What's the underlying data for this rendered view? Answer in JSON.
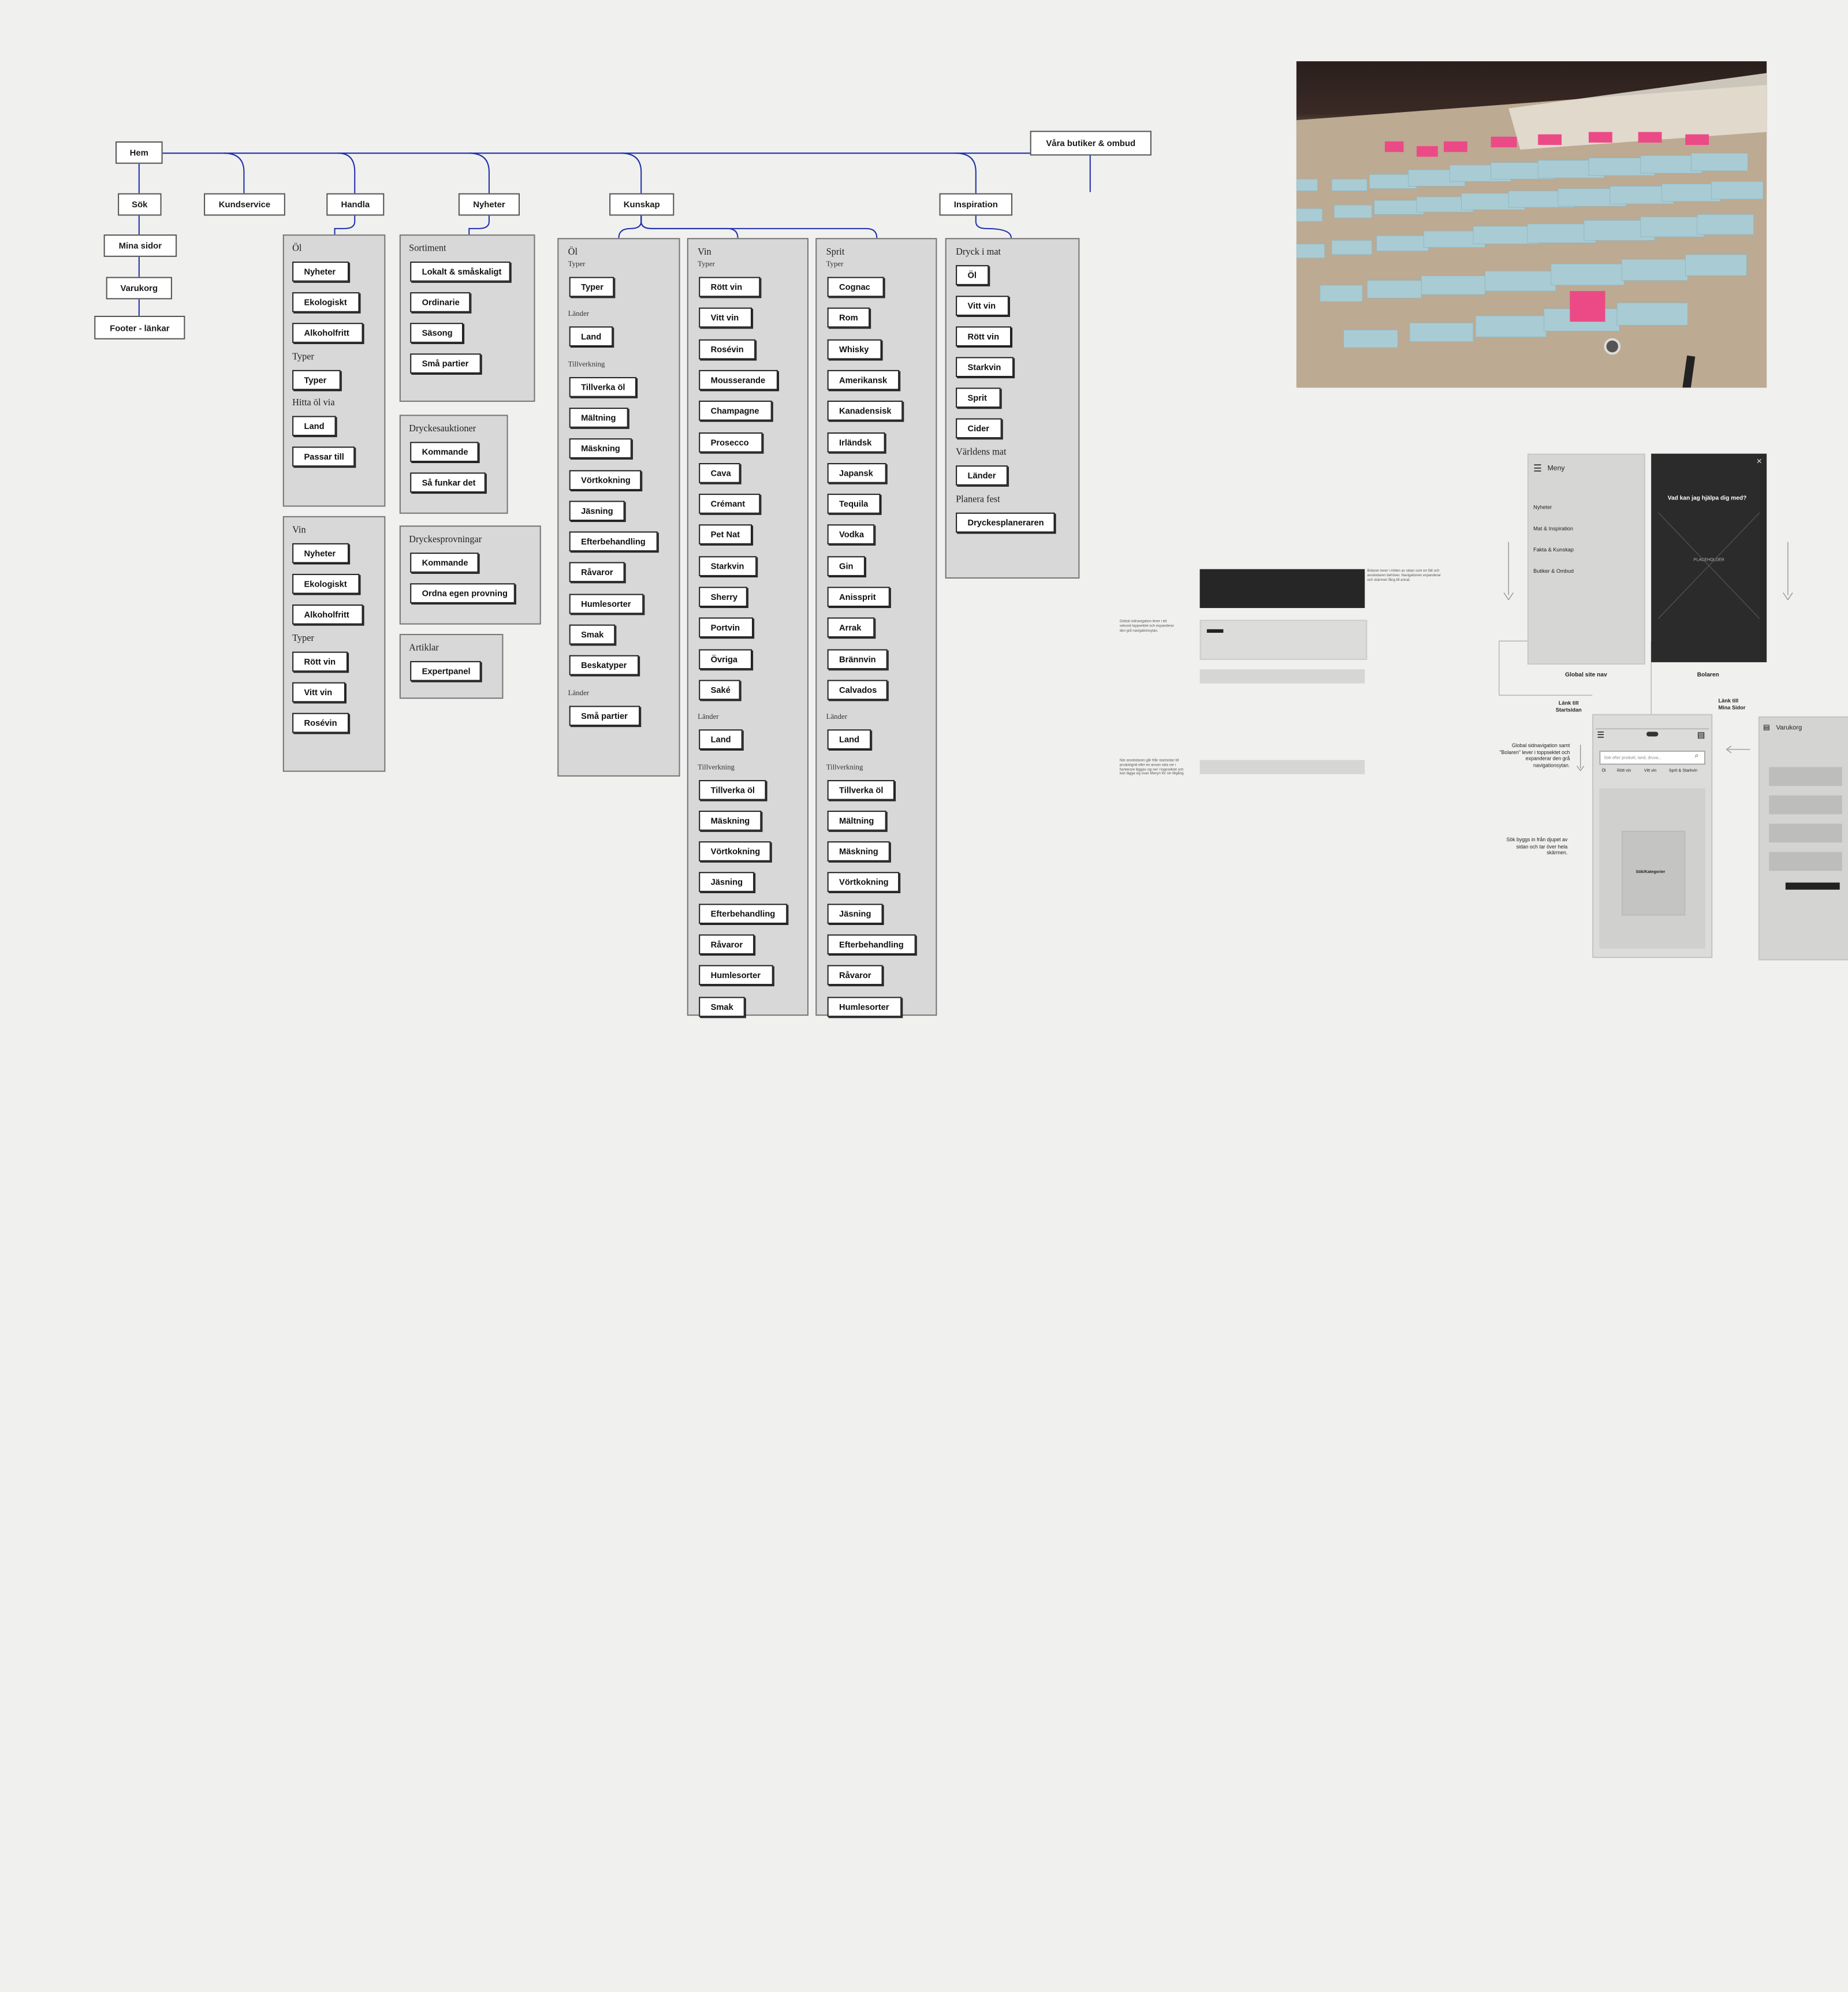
{
  "sitemap": {
    "nav": {
      "home": "Hem",
      "search": "Sök",
      "my_pages": "Mina sidor",
      "cart": "Varukorg",
      "footer": "Footer - länkar",
      "customer_service": "Kundservice",
      "shop": "Handla",
      "news": "Nyheter",
      "knowledge": "Kunskap",
      "inspiration": "Inspiration",
      "stores": "Våra butiker & ombud"
    },
    "handla": {
      "ol": {
        "title": "Öl",
        "items": [
          "Nyheter",
          "Ekologiskt",
          "Alkoholfritt"
        ],
        "types_label": "Typer",
        "types": [
          "Typer"
        ],
        "via_label": "Hitta öl via",
        "via": [
          "Land",
          "Passar till"
        ]
      },
      "vin": {
        "title": "Vin",
        "items": [
          "Nyheter",
          "Ekologiskt",
          "Alkoholfritt"
        ],
        "types_label": "Typer",
        "types": [
          "Rött vin",
          "Vitt vin",
          "Rosévin"
        ]
      }
    },
    "nyheter": {
      "sortiment": {
        "title": "Sortiment",
        "items": [
          "Lokalt & småskaligt",
          "Ordinarie",
          "Säsong",
          "Små partier"
        ]
      },
      "auktioner": {
        "title": "Dryckesauktioner",
        "items": [
          "Kommande",
          "Så funkar det"
        ]
      },
      "provningar": {
        "title": "Dryckesprovningar",
        "items": [
          "Kommande",
          "Ordna egen provning"
        ]
      },
      "artiklar": {
        "title": "Artiklar",
        "items": [
          "Expertpanel"
        ]
      }
    },
    "kunskap": {
      "ol": {
        "title": "Öl",
        "typer_label": "Typer",
        "typer": [
          "Typer"
        ],
        "lander_label": "Länder",
        "lander": [
          "Land"
        ],
        "tillverkning_label": "Tillverkning",
        "tillverkning": [
          "Tillverka öl",
          "Mältning",
          "Mäskning",
          "Vörtkokning",
          "Jäsning",
          "Efterbehandling",
          "Råvaror",
          "Humlesorter",
          "Smak",
          "Beskatyper"
        ],
        "lander2_label": "Länder",
        "lander2": [
          "Små partier"
        ]
      },
      "vin": {
        "title": "Vin",
        "typer_label": "Typer",
        "typer": [
          "Rött vin",
          "Vitt vin",
          "Rosévin",
          "Mousserande",
          "Champagne",
          "Prosecco",
          "Cava",
          "Crémant",
          "Pet Nat",
          "Starkvin",
          "Sherry",
          "Portvin",
          "Övriga",
          "Saké"
        ],
        "lander_label": "Länder",
        "lander": [
          "Land"
        ],
        "tillverkning_label": "Tillverkning",
        "tillverkning": [
          "Tillverka öl",
          "Mäskning",
          "Vörtkokning",
          "Jäsning",
          "Efterbehandling",
          "Råvaror",
          "Humlesorter",
          "Smak"
        ]
      },
      "sprit": {
        "title": "Sprit",
        "typer_label": "Typer",
        "typer": [
          "Cognac",
          "Rom",
          "Whisky",
          "Amerikansk",
          "Kanadensisk",
          "Irländsk",
          "Japansk",
          "Tequila",
          "Vodka",
          "Gin",
          "Anissprit",
          "Arrak",
          "Brännvin",
          "Calvados"
        ],
        "lander_label": "Länder",
        "lander": [
          "Land"
        ],
        "tillverkning_label": "Tillverkning",
        "tillverkning": [
          "Tillverka öl",
          "Mältning",
          "Mäskning",
          "Vörtkokning",
          "Jäsning",
          "Efterbehandling",
          "Råvaror",
          "Humlesorter"
        ]
      }
    },
    "inspiration": {
      "title": "Dryck i mat",
      "items": [
        "Öl",
        "Vitt vin",
        "Rött vin",
        "Starkvin",
        "Sprit",
        "Cider"
      ],
      "varldens_label": "Världens mat",
      "varldens": [
        "Länder"
      ],
      "planera_label": "Planera fest",
      "planera": [
        "Dryckesplaneraren"
      ]
    }
  },
  "wireframes": {
    "menu_label": "Meny",
    "menu_items": [
      "Nyheter",
      "Mat & Inspiration",
      "Fakta & Kunskap",
      "Butiker & Ombud"
    ],
    "dark_question": "Vad kan jag hjälpa dig med?",
    "placeholder": "PLACEHOLDER",
    "global_nav_caption": "Global site nav",
    "bolaren_caption": "Bolaren",
    "link_start": "Länk till Startsidan",
    "link_mina": "Länk till Mina Sidor",
    "varukorg": "Varukorg",
    "search_placeholder": "Sök efter produkt, land, druva...",
    "tabs": [
      "Öl",
      "Rött vin",
      "Vitt vin",
      "Sprit & Starkvin"
    ],
    "search_box": "Sök/Kategorier",
    "note_global": "Global sidnavigation samt \"Bolaren\" lever i toppsektet och expanderar den grå navigationsytan.",
    "note_search": "Sök byggs in från djupet av sidan och tar över hela skärmen.",
    "note_left1": "Global sidnavigation lever i ett sekund toppsektet och expanderar den grå navigationsytan.",
    "note_left2": "När användaren går från startsidan till produktgrid eller en annan sida ser i hanterare läggas sig ner i toppsektet och kan lägga sig ovan Menyn för sin tillgång.",
    "note_right": "Bolaren lever i mitten av sidan som en fält och användaren behöver. Navigationen expanderar och skärmen fång till annat."
  },
  "colors": {
    "connector": "#1f2fa8",
    "accent": "#f0a07a"
  }
}
